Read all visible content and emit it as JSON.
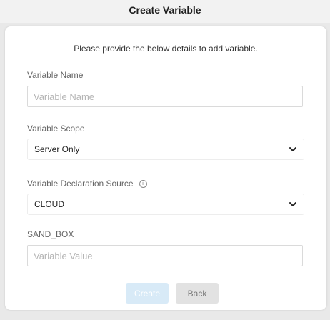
{
  "dialog": {
    "title": "Create Variable",
    "intro": "Please provide the below details to add variable."
  },
  "fields": {
    "variable_name": {
      "label": "Variable Name",
      "placeholder": "Variable Name",
      "value": ""
    },
    "variable_scope": {
      "label": "Variable Scope",
      "selected": "Server Only"
    },
    "declaration_source": {
      "label": "Variable Declaration Source",
      "info_icon": "info-icon",
      "selected": "CLOUD"
    },
    "sand_box": {
      "label": "SAND_BOX",
      "placeholder": "Variable Value",
      "value": ""
    }
  },
  "buttons": {
    "create_label": "Create",
    "back_label": "Back"
  },
  "colors": {
    "create_disabled_bg": "#d8eaf7",
    "back_bg": "#e2e2e2"
  }
}
